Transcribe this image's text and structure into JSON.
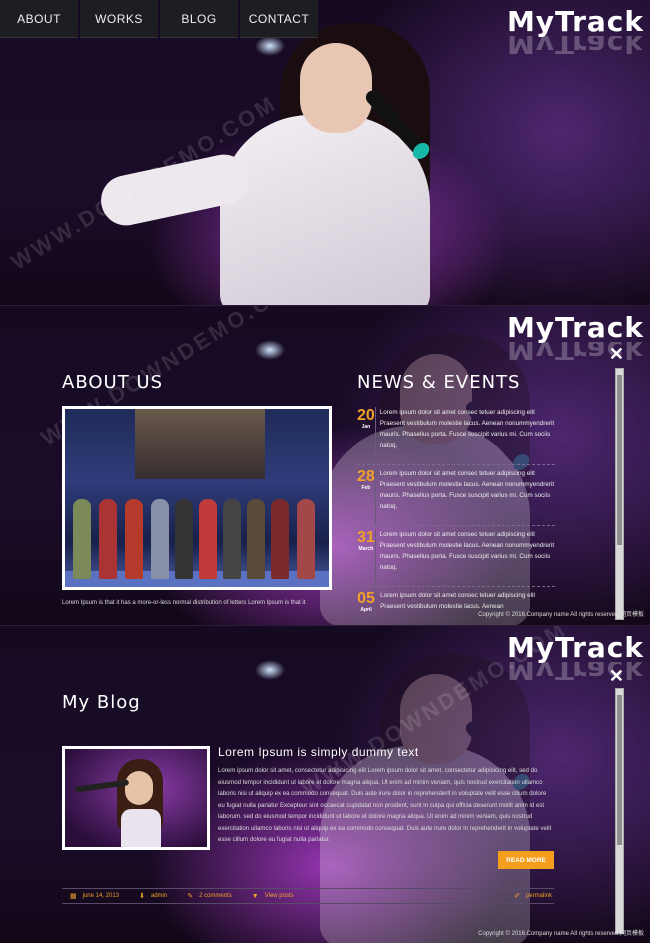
{
  "nav": {
    "items": [
      {
        "label": "ABOUT"
      },
      {
        "label": "WORKS"
      },
      {
        "label": "BLOG"
      },
      {
        "label": "CONTACT"
      }
    ]
  },
  "logo": {
    "text": "MyTrack"
  },
  "about": {
    "title": "ABOUT US",
    "text": "Lorem Ipsum is that it has a more-or-less normal distribution of letters Lorem Ipsum is that it"
  },
  "news": {
    "title": "NEWS & EVENTS",
    "items": [
      {
        "day": "20",
        "month": "Jan",
        "text": "Lorem ipsum dolor sit amet consec tetuer adipiscing elit Praesent vestibulum molestie lacus. Aenean nonummyendrerit mauris. Phasellus porta. Fusce suscipit varius mi. Cum sociis natoq."
      },
      {
        "day": "28",
        "month": "Feb",
        "text": "Lorem ipsum dolor sit amet consec tetuer adipiscing elit Praesent vestibulum molestie lacus. Aenean nonummyendrerit mauris. Phasellus porta. Fusce suscipit varius mi. Cum sociis natoq."
      },
      {
        "day": "31",
        "month": "March",
        "text": "Lorem ipsum dolor sit amet consec tetuer adipiscing elit Praesent vestibulum molestie lacus. Aenean nonummyendrerit mauris. Phasellus porta. Fusce suscipit varius mi. Cum sociis natoq."
      },
      {
        "day": "05",
        "month": "April",
        "text": "Lorem ipsum dolor sit amet consec tetuer adipiscing elit Praesent vestibulum molestie lacus. Aenean"
      }
    ]
  },
  "copyright": "Copyright © 2016.Company name All rights reserved.网页模板",
  "blog": {
    "title": "My Blog",
    "post_title": "Lorem Ipsum is simply dummy text",
    "post_body": "Lorem ipsum dolor sit amet, consectetur adipisicing elit Lorem ipsum dolor sit amet, consectetur adipisicing elit, sed do eiusmod tempor incididunt ut labore et dolore magna aliqua. Ut enim ad minim veniam, quis nostrud exercitation ullamco laboris nisi ut aliquip ex ea commodo consequat. Duis aute irure dolor in reprehenderit in voluptate velit esse cillum dolore eu fugiat nulla pariatur Excepteur sint occaecat cupidatat non proident, sunt in culpa qui officia deserunt mollit anim id est laborum. sed do eiusmod tempor incididunt ut labore et dolore magna aliqua. Ut enim ad minim veniam, quis nostrud exercitation ullamco laboris nisi ut aliquip ex ea commodo consequat. Duis aute irure dolor in reprehenderit in voluptate velit esse cillum dolore eu fugiat nulla pariatur.",
    "read_more": "READ MORE",
    "meta": {
      "date": "june 14, 2013",
      "author": "admin",
      "comments": "2 comments",
      "views": "View posts",
      "permalink": "permalink"
    }
  },
  "watermark": "WWW.DOWNDEMO.COM",
  "colors": {
    "accent": "#f59d1d",
    "date": "#f1a12a"
  }
}
